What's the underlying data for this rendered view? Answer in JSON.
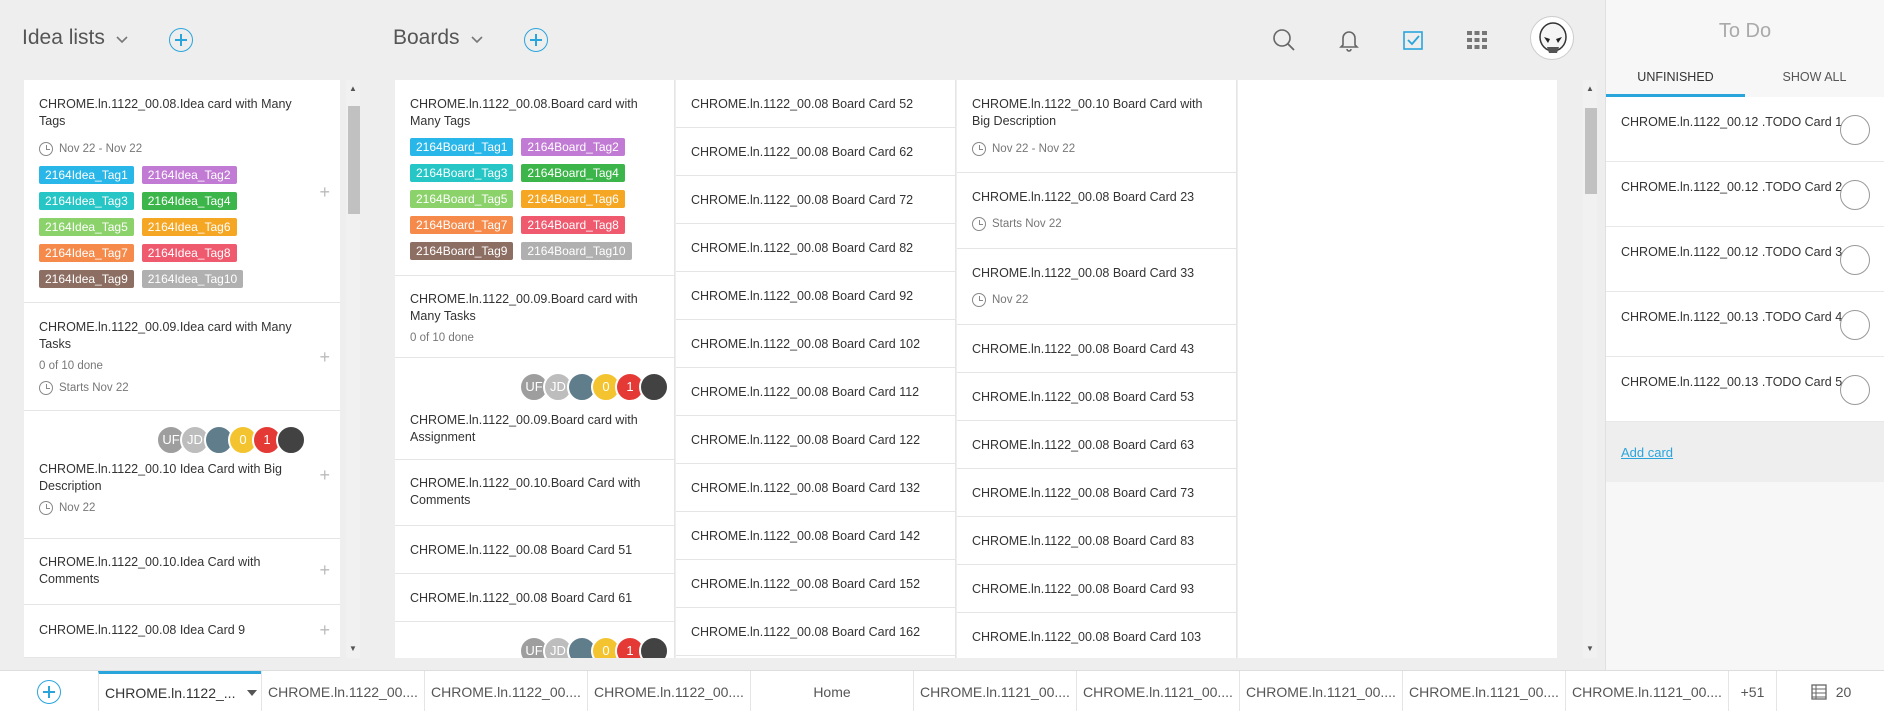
{
  "header": {
    "idea_lists_label": "Idea lists",
    "boards_label": "Boards"
  },
  "idea_list": {
    "card1": {
      "title": "CHROME.ln.1122_00.08.Idea card with Many Tags",
      "date": "Nov 22 - Nov 22",
      "tags": [
        {
          "label": "2164Idea_Tag1",
          "color": "#29b6e8"
        },
        {
          "label": "2164Idea_Tag2",
          "color": "#c27bd4"
        },
        {
          "label": "2164Idea_Tag3",
          "color": "#26c6c6"
        },
        {
          "label": "2164Idea_Tag4",
          "color": "#3cb54a"
        },
        {
          "label": "2164Idea_Tag5",
          "color": "#8bd26a"
        },
        {
          "label": "2164Idea_Tag6",
          "color": "#f5a623"
        },
        {
          "label": "2164Idea_Tag7",
          "color": "#f58a4b"
        },
        {
          "label": "2164Idea_Tag8",
          "color": "#ef5a6f"
        },
        {
          "label": "2164Idea_Tag9",
          "color": "#8d6e63"
        },
        {
          "label": "2164Idea_Tag10",
          "color": "#b0b0b0"
        }
      ]
    },
    "card2": {
      "title": "CHROME.ln.1122_00.09.Idea card with Many Tasks",
      "tasks": "0 of 10 done",
      "date": "Starts Nov 22"
    },
    "card3": {
      "title": "CHROME.ln.1122_00.10 Idea Card with Big Description",
      "date": "Nov 22"
    },
    "card4": {
      "title": "CHROME.ln.1122_00.10.Idea Card with Comments"
    },
    "card5": {
      "title": "CHROME.ln.1122_00.08 Idea Card 9"
    }
  },
  "avatars": [
    {
      "label": "UF",
      "color": "#9e9e9e"
    },
    {
      "label": "JD",
      "color": "#bdbdbd"
    },
    {
      "label": "",
      "color": "#607d8b"
    },
    {
      "label": "0",
      "color": "#f4c430"
    },
    {
      "label": "1",
      "color": "#e53935"
    },
    {
      "label": "",
      "color": "#424242"
    }
  ],
  "board_col1": {
    "card1": {
      "title": "CHROME.ln.1122_00.08.Board card with Many Tags",
      "tags": [
        {
          "label": "2164Board_Tag1",
          "color": "#29b6e8"
        },
        {
          "label": "2164Board_Tag2",
          "color": "#c27bd4"
        },
        {
          "label": "2164Board_Tag3",
          "color": "#26c6c6"
        },
        {
          "label": "2164Board_Tag4",
          "color": "#3cb54a"
        },
        {
          "label": "2164Board_Tag5",
          "color": "#8bd26a"
        },
        {
          "label": "2164Board_Tag6",
          "color": "#f5a623"
        },
        {
          "label": "2164Board_Tag7",
          "color": "#f58a4b"
        },
        {
          "label": "2164Board_Tag8",
          "color": "#ef5a6f"
        },
        {
          "label": "2164Board_Tag9",
          "color": "#8d6e63"
        },
        {
          "label": "2164Board_Tag10",
          "color": "#b0b0b0"
        }
      ]
    },
    "card2": {
      "title": "CHROME.ln.1122_00.09.Board card with Many Tasks",
      "tasks": "0 of 10 done"
    },
    "card3": {
      "title": "CHROME.ln.1122_00.09.Board card with Assignment"
    },
    "card4": {
      "title": "CHROME.ln.1122_00.10.Board Card with Comments"
    },
    "card5": {
      "title": "CHROME.ln.1122_00.08 Board Card 51"
    },
    "card6": {
      "title": "CHROME.ln.1122_00.08 Board Card 61"
    }
  },
  "board_col2": [
    "CHROME.ln.1122_00.08 Board Card 52",
    "CHROME.ln.1122_00.08 Board Card 62",
    "CHROME.ln.1122_00.08 Board Card 72",
    "CHROME.ln.1122_00.08 Board Card 82",
    "CHROME.ln.1122_00.08 Board Card 92",
    "CHROME.ln.1122_00.08 Board Card 102",
    "CHROME.ln.1122_00.08 Board Card 112",
    "CHROME.ln.1122_00.08 Board Card 122",
    "CHROME.ln.1122_00.08 Board Card 132",
    "CHROME.ln.1122_00.08 Board Card 142",
    "CHROME.ln.1122_00.08 Board Card 152",
    "CHROME.ln.1122_00.08 Board Card 162"
  ],
  "board_col3": {
    "card1": {
      "title": "CHROME.ln.1122_00.10 Board Card with Big Description",
      "date": "Nov 22 - Nov 22"
    },
    "card2": {
      "title": "CHROME.ln.1122_00.08 Board Card 23",
      "date": "Starts Nov 22"
    },
    "card3": {
      "title": "CHROME.ln.1122_00.08 Board Card 33",
      "date": "Nov 22"
    },
    "rest": [
      "CHROME.ln.1122_00.08 Board Card 43",
      "CHROME.ln.1122_00.08 Board Card 53",
      "CHROME.ln.1122_00.08 Board Card 63",
      "CHROME.ln.1122_00.08 Board Card 73",
      "CHROME.ln.1122_00.08 Board Card 83",
      "CHROME.ln.1122_00.08 Board Card 93",
      "CHROME.ln.1122_00.08 Board Card 103"
    ]
  },
  "todo": {
    "title": "To Do",
    "tab_unfinished": "UNFINISHED",
    "tab_show_all": "SHOW ALL",
    "items": [
      "CHROME.ln.1122_00.12 .TODO Card 1",
      "CHROME.ln.1122_00.12 .TODO Card 2",
      "CHROME.ln.1122_00.12 .TODO Card 3",
      "CHROME.ln.1122_00.13 .TODO Card 4",
      "CHROME.ln.1122_00.13 .TODO Card 5"
    ],
    "add_card": "Add card"
  },
  "tabbar": {
    "tabs": [
      "CHROME.ln.1122_...",
      "CHROME.ln.1122_00....",
      "CHROME.ln.1122_00....",
      "CHROME.ln.1122_00....",
      "Home",
      "CHROME.ln.1121_00....",
      "CHROME.ln.1121_00....",
      "CHROME.ln.1121_00....",
      "CHROME.ln.1121_00....",
      "CHROME.ln.1121_00...."
    ],
    "more": "+51",
    "count": "20"
  },
  "colors": {
    "accent": "#2aa5dc"
  }
}
